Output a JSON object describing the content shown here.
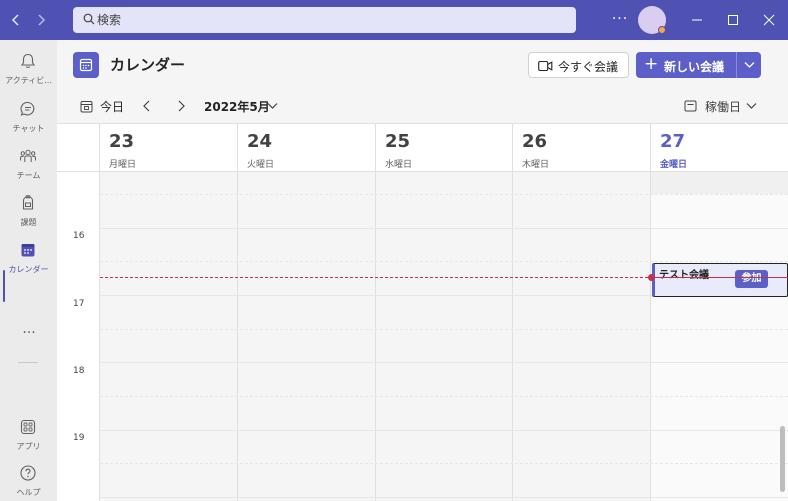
{
  "titlebar": {
    "search_placeholder": "検索",
    "more_label": "···",
    "accent": "#4f52b2"
  },
  "rail": {
    "items": [
      {
        "label": "アクティビ...",
        "icon": "bell-icon"
      },
      {
        "label": "チャット",
        "icon": "chat-icon"
      },
      {
        "label": "チーム",
        "icon": "teams-icon"
      },
      {
        "label": "課題",
        "icon": "assignments-icon"
      },
      {
        "label": "カレンダー",
        "icon": "calendar-icon",
        "active": true
      },
      {
        "label": "アプリ",
        "icon": "apps-icon"
      },
      {
        "label": "ヘルプ",
        "icon": "help-icon"
      }
    ],
    "more_label": "···"
  },
  "header": {
    "title": "カレンダー",
    "meet_now_label": "今すぐ会議",
    "new_meeting_label": "新しい会議",
    "new_meeting_plus": "+"
  },
  "toolbar": {
    "today_label": "今日",
    "month_label": "2022年5月",
    "view_label": "稼働日"
  },
  "calendar": {
    "days": [
      {
        "num": "23",
        "name": "月曜日"
      },
      {
        "num": "24",
        "name": "火曜日"
      },
      {
        "num": "25",
        "name": "水曜日"
      },
      {
        "num": "26",
        "name": "木曜日"
      },
      {
        "num": "27",
        "name": "金曜日",
        "today": true
      }
    ],
    "hours": [
      "16",
      "17",
      "18",
      "19"
    ],
    "event": {
      "title": "テスト会議",
      "join_label": "参加"
    }
  },
  "colors": {
    "brand": "#5b5fc7",
    "now_line": "#c4314b",
    "event_bg": "#e8ebfa"
  }
}
